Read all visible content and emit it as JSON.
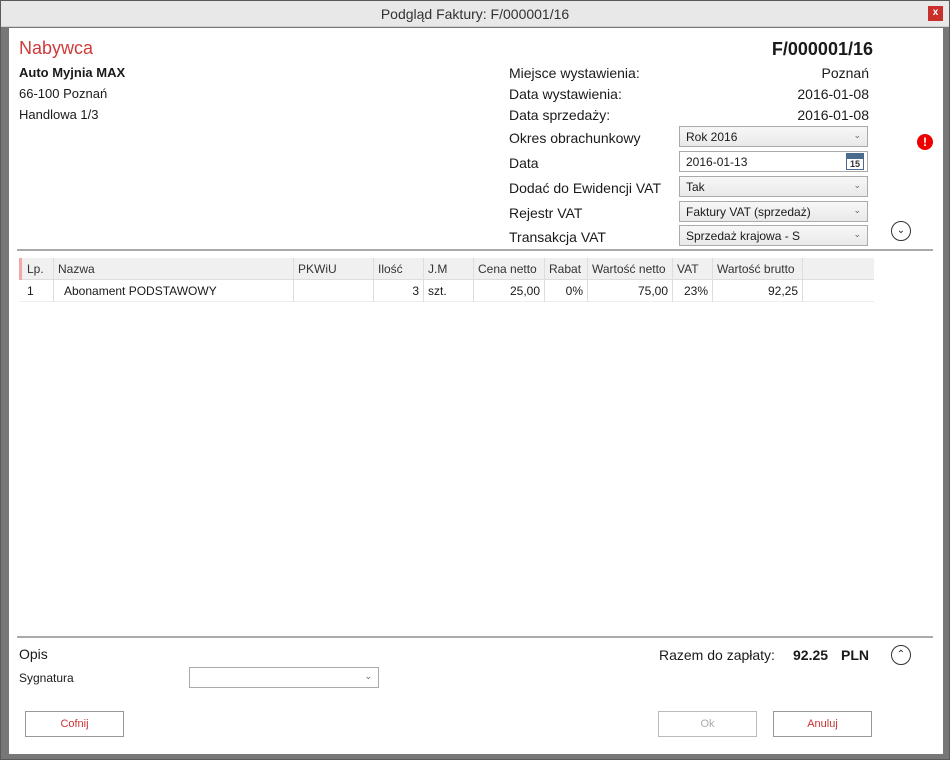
{
  "window": {
    "title": "Podgląd Faktury: F/000001/16",
    "close_label": "x"
  },
  "buyer": {
    "heading": "Nabywca",
    "name": "Auto Myjnia MAX",
    "address_line1": "66-100 Poznań",
    "address_line2": "Handlowa 1/3"
  },
  "invoice": {
    "number": "F/000001/16",
    "place_label": "Miejsce wystawienia:",
    "place_value": "Poznań",
    "issue_date_label": "Data wystawienia:",
    "issue_date_value": "2016-01-08",
    "sale_date_label": "Data sprzedaży:",
    "sale_date_value": "2016-01-08",
    "period_label": "Okres obrachunkowy",
    "period_value": "Rok 2016",
    "date_label": "Data",
    "date_value": "2016-01-13",
    "calendar_day": "15",
    "vat_register_add_label": "Dodać do Ewidencji VAT",
    "vat_register_add_value": "Tak",
    "vat_register_label": "Rejestr VAT",
    "vat_register_value": "Faktury VAT (sprzedaż)",
    "vat_transaction_label": "Transakcja VAT",
    "vat_transaction_value": "Sprzedaż krajowa - S"
  },
  "table": {
    "columns": [
      "Lp.",
      "Nazwa",
      "PKWiU",
      "Ilość",
      "J.M",
      "Cena netto",
      "Rabat",
      "Wartość netto",
      "VAT",
      "Wartość brutto"
    ],
    "rows": [
      [
        "1",
        "Abonament PODSTAWOWY",
        "",
        "3",
        "szt.",
        "25,00",
        "0%",
        "75,00",
        "23%",
        "92,25"
      ]
    ]
  },
  "footer": {
    "description_label": "Opis",
    "signature_label": "Sygnatura",
    "signature_value": "",
    "total_label": "Razem do zapłaty:",
    "total_value": "92.25",
    "currency": "PLN"
  },
  "buttons": {
    "back": "Cofnij",
    "ok": "Ok",
    "cancel": "Anuluj"
  }
}
